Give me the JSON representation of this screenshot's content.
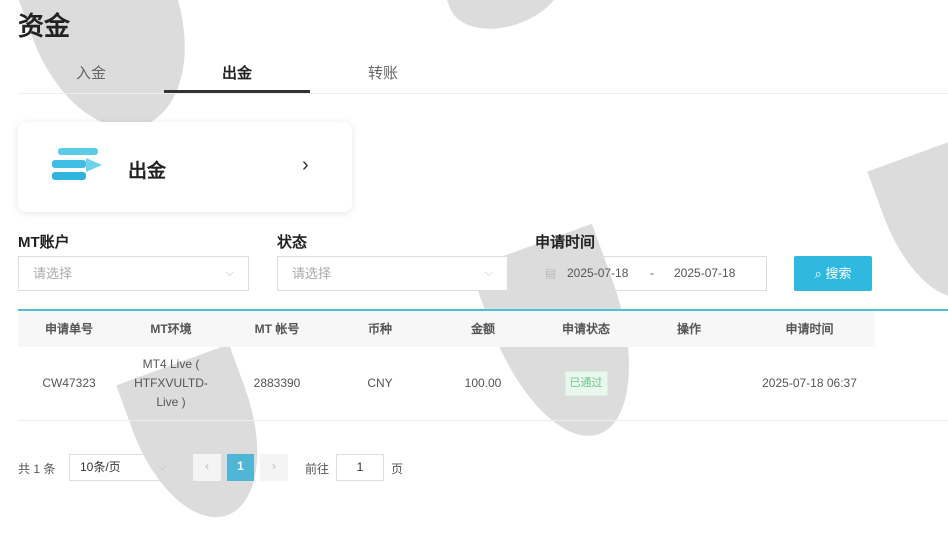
{
  "page": {
    "title": "资金"
  },
  "tabs": [
    {
      "label": "入金"
    },
    {
      "label": "出金"
    },
    {
      "label": "转账"
    }
  ],
  "card": {
    "label": "出金",
    "icon": "withdraw-icon"
  },
  "filters": {
    "mt_account": {
      "label": "MT账户",
      "placeholder": "请选择"
    },
    "status": {
      "label": "状态",
      "placeholder": "请选择"
    },
    "date": {
      "label": "申请时间",
      "start": "2025-07-18",
      "sep": "-",
      "end": "2025-07-18"
    },
    "search_label": "搜索"
  },
  "table": {
    "headers": [
      "申请单号",
      "MT环境",
      "MT 帐号",
      "币种",
      "金额",
      "申请状态",
      "操作",
      "申请时间"
    ],
    "rows": [
      {
        "id": "CW47323",
        "env": "MT4 Live ( HTFXVULTD-Live )",
        "account": "2883390",
        "currency": "CNY",
        "amount": "100.00",
        "status": "已通过",
        "action": "",
        "time": "2025-07-18 06:37"
      }
    ]
  },
  "pagination": {
    "total": "共 1 条",
    "page_size": "10条/页",
    "current": "1",
    "goto_label": "前往",
    "goto_value": "1",
    "page_suffix": "页"
  },
  "colors": {
    "accent": "#2fb8e0",
    "success": "#6cc787"
  }
}
